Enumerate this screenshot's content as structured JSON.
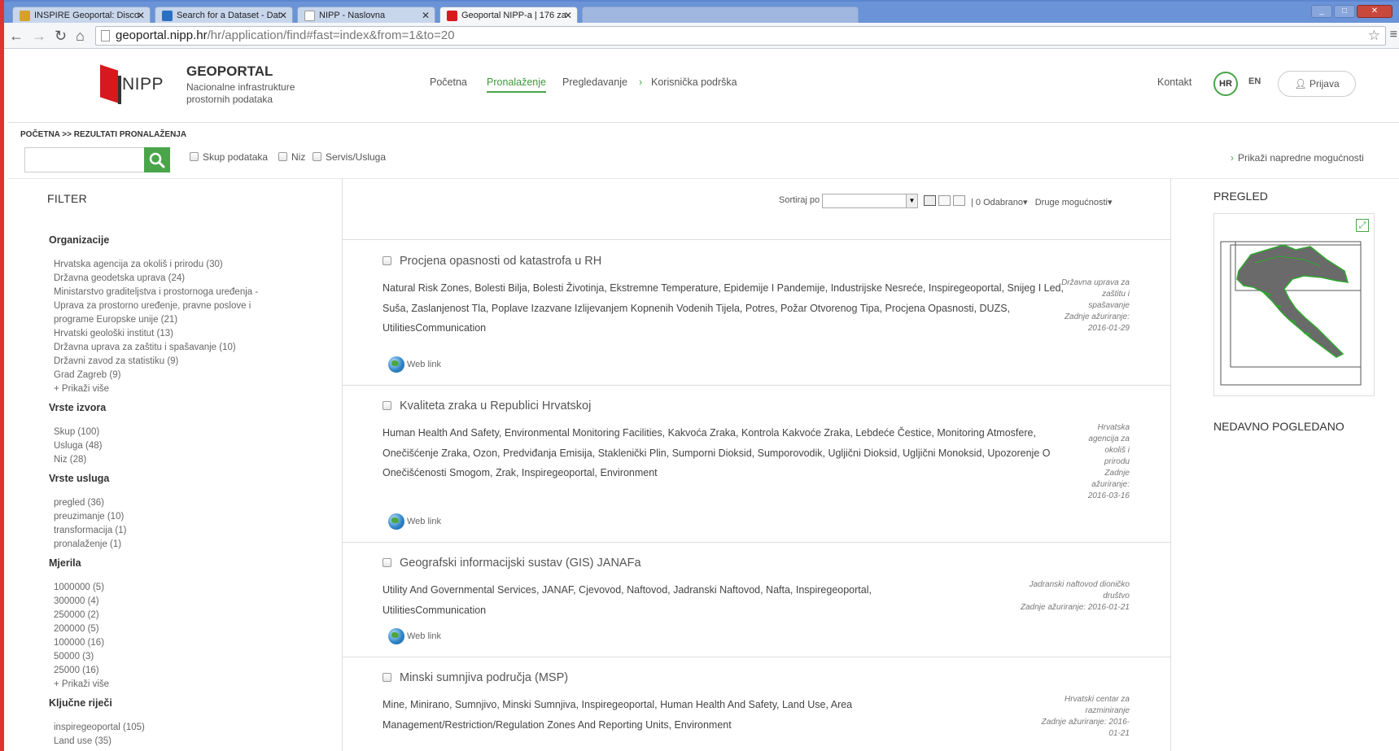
{
  "browser": {
    "tabs": [
      {
        "title": "INSPIRE Geoportal: Disco",
        "favicon_color": "#d6a12b"
      },
      {
        "title": "Search for a Dataset - Dat",
        "favicon_color": "#2b6fc2"
      },
      {
        "title": "NIPP - Naslovna",
        "favicon_color": "#ffffff"
      },
      {
        "title": "Geoportal NIPP-a | 176 za",
        "favicon_color": "#d7191f"
      }
    ],
    "url_host": "geoportal.nipp.hr",
    "url_path": "/hr/application/find#fast=index&from=1&to=20"
  },
  "header": {
    "logo_text": "NIPP",
    "brand_title": "GEOPORTAL",
    "brand_subtitle": "Nacionalne infrastrukture prostornih podataka",
    "nav": [
      "Početna",
      "Pronalaženje",
      "Pregledavanje",
      "Korisnička podrška"
    ],
    "contact": "Kontakt",
    "lang_hr": "HR",
    "lang_en": "EN",
    "login": "Prijava"
  },
  "search": {
    "breadcrumb": "POČETNA >> REZULTATI PRONALAŽENJA",
    "query": "",
    "types": [
      "Skup podataka",
      "Niz",
      "Servis/Usluga"
    ],
    "advanced": "Prikaži napredne mogućnosti"
  },
  "filter": {
    "title": "FILTER",
    "organizations_title": "Organizacije",
    "organizations": [
      "Hrvatska agencija za okoliš i prirodu (30)",
      "Državna geodetska uprava (24)",
      "Ministarstvo graditeljstva i prostornoga uređenja - Uprava za prostorno uređenje, pravne poslove i programe Europske unije (21)",
      "Hrvatski geološki institut (13)",
      "Državna uprava za zaštitu i spašavanje (10)",
      "Državni zavod za statistiku (9)",
      "Grad Zagreb (9)",
      "+ Prikaži više"
    ],
    "source_types_title": "Vrste izvora",
    "source_types": [
      "Skup (100)",
      "Usluga (48)",
      "Niz (28)"
    ],
    "service_types_title": "Vrste usluga",
    "service_types": [
      "pregled (36)",
      "preuzimanje (10)",
      "transformacija (1)",
      "pronalaženje (1)"
    ],
    "scales_title": "Mjerila",
    "scales": [
      "1000000 (5)",
      "300000 (4)",
      "250000 (2)",
      "200000 (5)",
      "100000 (16)",
      "50000 (3)",
      "25000 (16)",
      "+ Prikaži više"
    ],
    "keywords_title": "Ključne riječi",
    "keywords": [
      "inspiregeoportal (105)",
      "Land use (35)"
    ]
  },
  "toolbar": {
    "sort_label": "Sortiraj po",
    "sort_value": "",
    "selected": "0 Odabrano",
    "more": "Druge mogućnosti"
  },
  "results": [
    {
      "title": "Procjena opasnosti od katastrofa u RH",
      "keywords": "Natural Risk Zones, Bolesti Bilja, Bolesti Životinja, Ekstremne Temperature, Epidemije I Pandemije, Industrijske Nesreće, Inspiregeoportal, Snijeg I Led, Suša, Zaslanjenost Tla, Poplave Izazvane Izlijevanjem Kopnenih Vodenih Tijela, Potres, Požar Otvorenog Tipa, Procjena Opasnosti, DUZS, UtilitiesCommunication",
      "org": "Državna uprava za zaštitu i spašavanje",
      "updated": "Zadnje ažuriranje: 2016-01-29",
      "link": "Web link"
    },
    {
      "title": "Kvaliteta zraka u Republici Hrvatskoj",
      "keywords": "Human Health And Safety, Environmental Monitoring Facilities, Kakvoća Zraka, Kontrola Kakvoće Zraka, Lebdeće Čestice, Monitoring Atmosfere, Onečišćenje Zraka, Ozon, Predviđanja Emisija, Staklenički Plin, Sumporni Dioksid, Sumporovodik, Ugljični Dioksid, Ugljični Monoksid, Upozorenje O Onečišćenosti Smogom, Zrak, Inspiregeoportal, Environment",
      "org": "Hrvatska agencija za okoliš i prirodu",
      "updated": "Zadnje ažuriranje: 2016-03-16",
      "link": "Web link"
    },
    {
      "title": "Geografski informacijski sustav (GIS) JANAFa",
      "keywords": "Utility And Governmental Services, JANAF, Cjevovod, Naftovod, Jadranski Naftovod, Nafta, Inspiregeoportal, UtilitiesCommunication",
      "org": "Jadranski naftovod dioničko društvo",
      "updated": "Zadnje ažuriranje: 2016-01-21",
      "link": "Web link"
    },
    {
      "title": "Minski sumnjiva područja (MSP)",
      "keywords": "Mine, Minirano, Sumnjivo, Minski Sumnjiva, Inspiregeoportal, Human Health And Safety, Land Use, Area Management/Restriction/Regulation Zones And Reporting Units, Environment",
      "org": "Hrvatski centar za razminiranje",
      "updated": "Zadnje ažuriranje: 2016-01-21",
      "link": ""
    }
  ],
  "right": {
    "preview_title": "PREGLED",
    "recent_title": "NEDAVNO POGLEDANO"
  },
  "colors": {
    "accent": "#4aa54a",
    "brand_red": "#d7191f"
  }
}
